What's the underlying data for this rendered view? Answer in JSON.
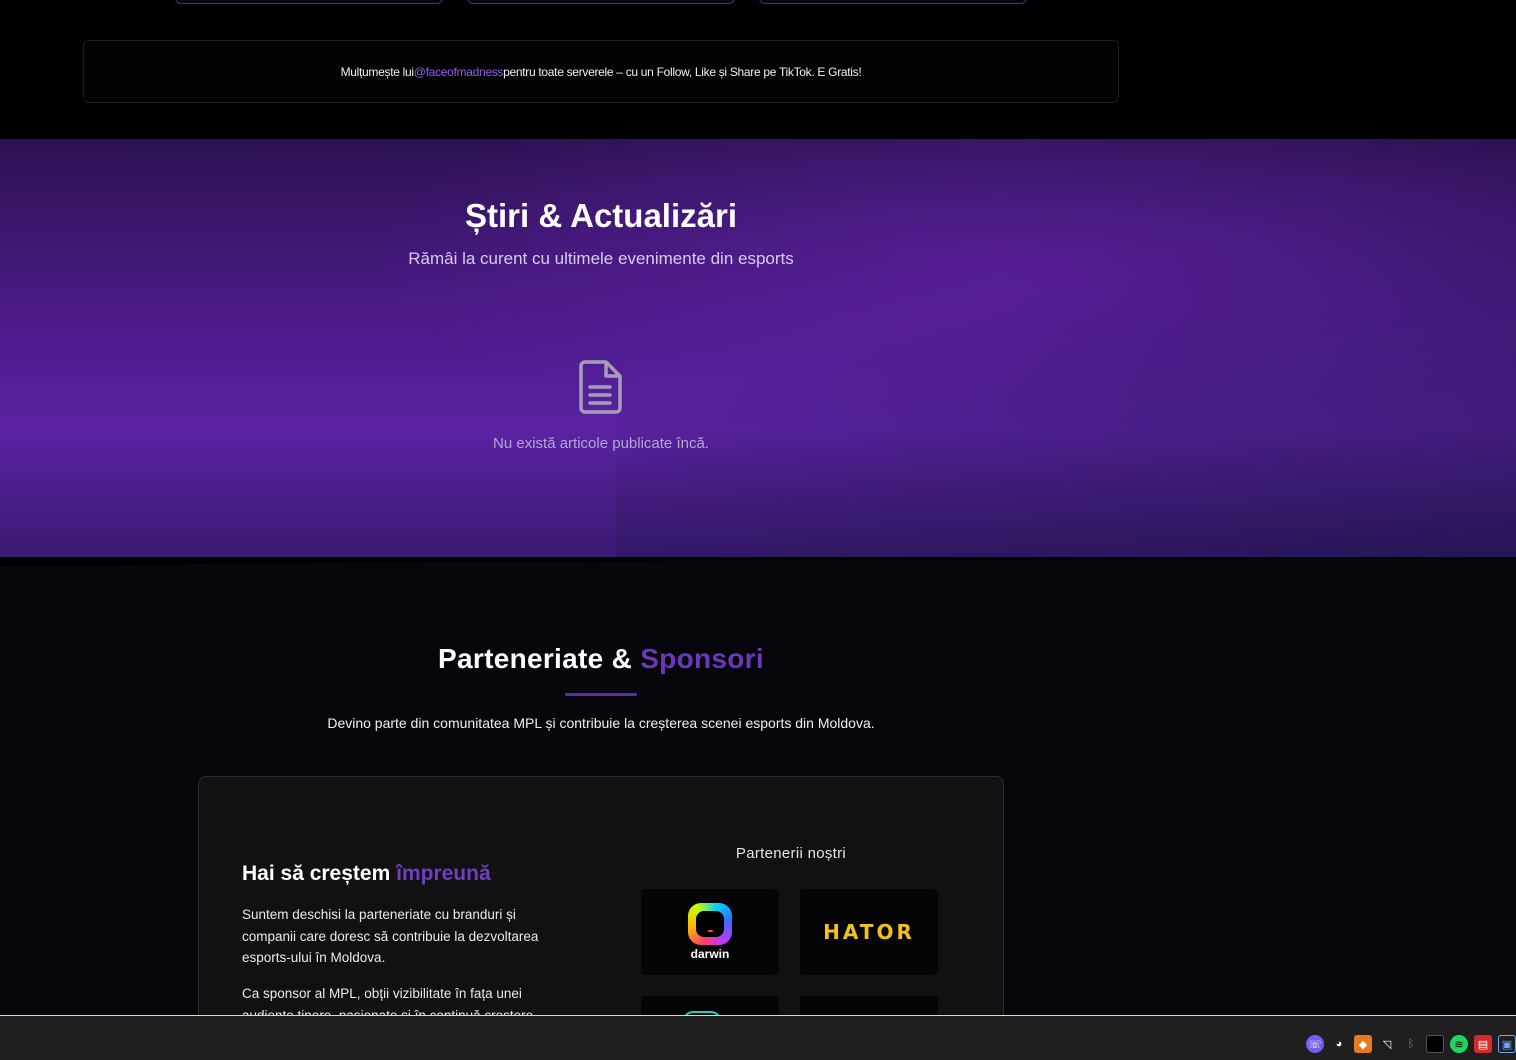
{
  "thanks_banner": {
    "prefix": "Mulțumește lui ",
    "handle": "@faceofmadness",
    "suffix": " pentru toate serverele – cu un Follow, Like și Share pe TikTok. E Gratis!"
  },
  "news": {
    "title": "Știri & Actualizări",
    "subtitle": "Rămâi la curent cu ultimele evenimente din esports",
    "empty_icon": "document-icon",
    "empty_text": "Nu există articole publicate încă."
  },
  "partners": {
    "title_main": "Parteneriate & ",
    "title_accent": "Sponsori",
    "subtitle": "Devino parte din comunitatea MPL și contribuie la creșterea scenei esports din Moldova.",
    "card": {
      "heading_main": "Hai să creștem ",
      "heading_accent": "împreună",
      "paragraph_1": "Suntem deschisi la parteneriate cu branduri și companii care doresc să contribuie la dezvoltarea esports-ului în Moldova.",
      "paragraph_2": "Ca sponsor al MPL, obții vizibilitate în fața unei audiențe tinere, pasionate și în continuă creștere.",
      "our_partners_label": "Partenerii noștri",
      "logos": [
        {
          "name": "darwin",
          "text": "darwin"
        },
        {
          "name": "hator",
          "text": "HATOR"
        }
      ]
    }
  },
  "colors": {
    "accent": "#6a38b8",
    "link": "#8f5fe8",
    "hator_yellow": "#f2c21b"
  },
  "taskbar": {
    "tray_icons": [
      "viber-icon",
      "discord-icon",
      "app-icon",
      "amd-icon",
      "bluetooth-icon",
      "window-icon",
      "spotify-icon",
      "pdf-icon",
      "network-icon"
    ]
  }
}
